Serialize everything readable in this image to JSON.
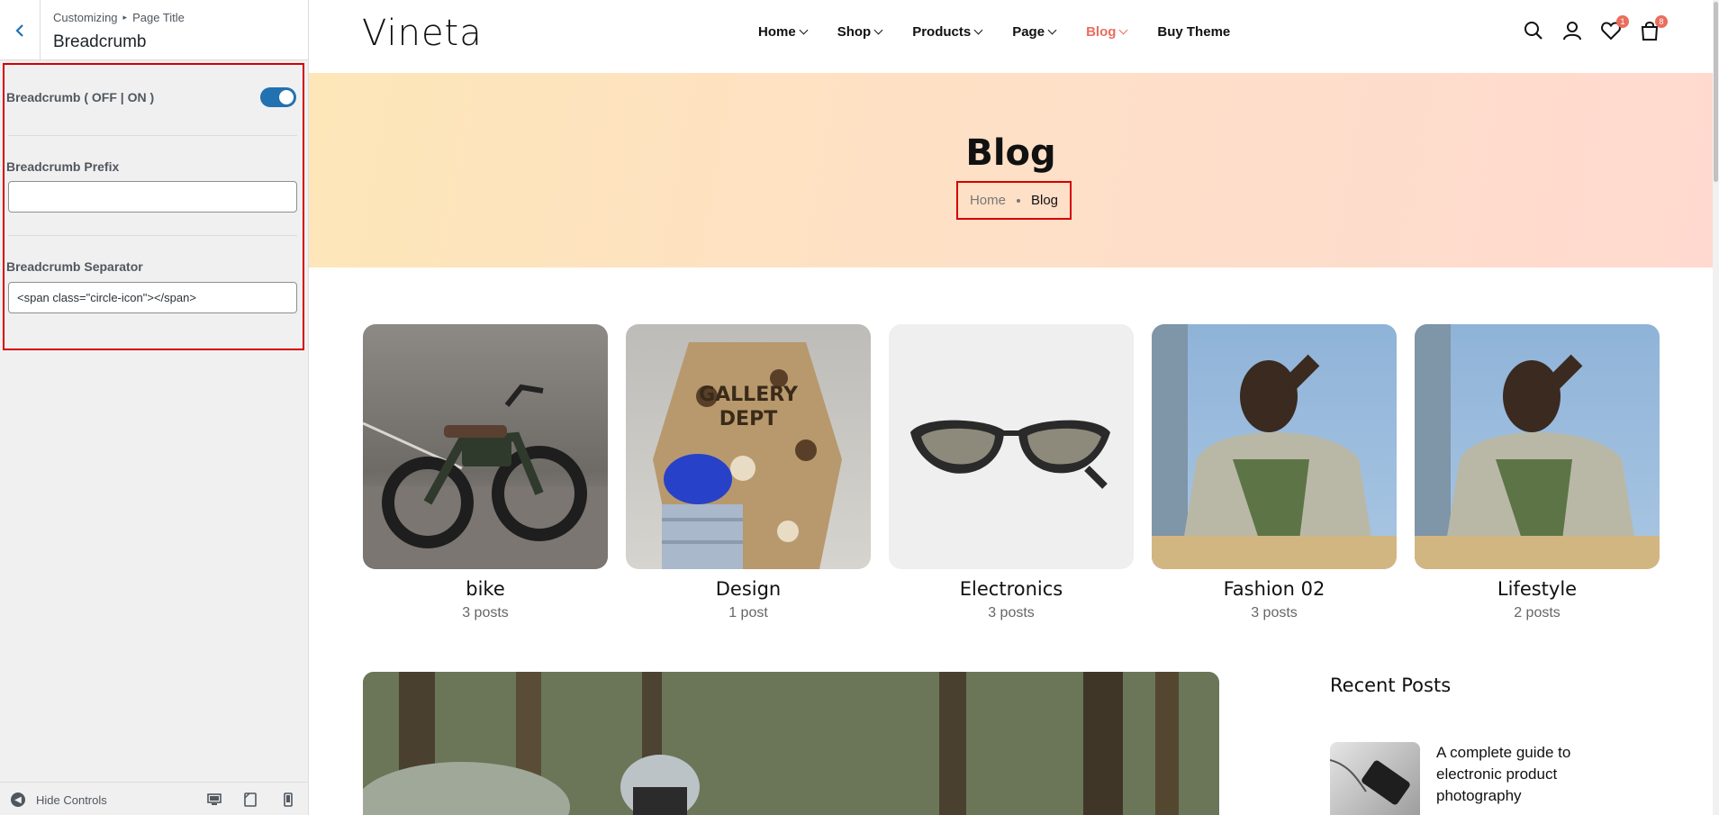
{
  "sidebar": {
    "breadcrumb": {
      "root": "Customizing",
      "section": "Page Title"
    },
    "title": "Breadcrumb",
    "controls": {
      "toggle_label": "Breadcrumb ( OFF | ON )",
      "toggle_on": true,
      "prefix_label": "Breadcrumb Prefix",
      "prefix_value": "",
      "separator_label": "Breadcrumb Separator",
      "separator_value": "<span class=\"circle-icon\"></span>"
    },
    "footer": {
      "hide_controls": "Hide Controls"
    }
  },
  "site": {
    "logo": "Vineta",
    "nav": [
      {
        "label": "Home",
        "dropdown": true,
        "active": false
      },
      {
        "label": "Shop",
        "dropdown": true,
        "active": false
      },
      {
        "label": "Products",
        "dropdown": true,
        "active": false
      },
      {
        "label": "Page",
        "dropdown": true,
        "active": false
      },
      {
        "label": "Blog",
        "dropdown": true,
        "active": true
      },
      {
        "label": "Buy Theme",
        "dropdown": false,
        "active": false
      }
    ],
    "wishlist_count": "1",
    "cart_count": "8",
    "accent_color": "#ea6d5d"
  },
  "hero": {
    "title": "Blog",
    "breadcrumb_home": "Home",
    "breadcrumb_current": "Blog"
  },
  "categories": [
    {
      "name": "bike",
      "count": "3 posts"
    },
    {
      "name": "Design",
      "count": "1 post"
    },
    {
      "name": "Electronics",
      "count": "3 posts"
    },
    {
      "name": "Fashion 02",
      "count": "3 posts"
    },
    {
      "name": "Lifestyle",
      "count": "2 posts"
    }
  ],
  "recent_posts": {
    "title": "Recent Posts",
    "items": [
      {
        "title": "A complete guide to electronic product photography"
      }
    ]
  }
}
